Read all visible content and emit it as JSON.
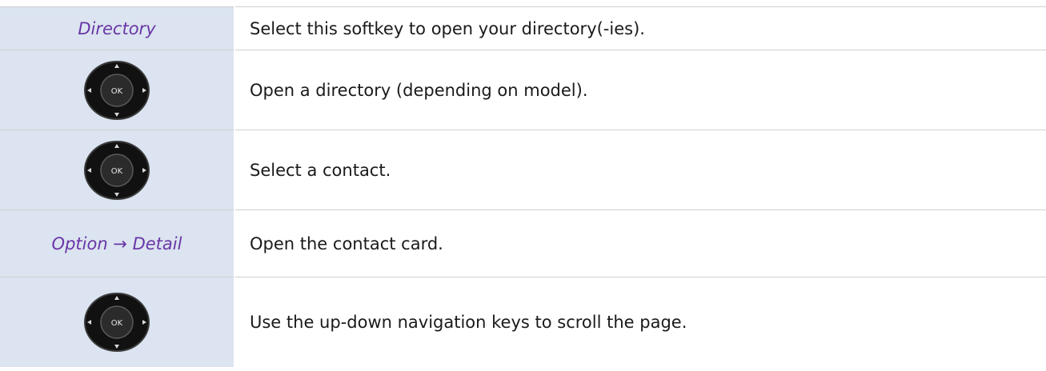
{
  "rows": [
    {
      "key_type": "softkey",
      "key_label": "Directory",
      "description": "Select this softkey to open your directory(-ies)."
    },
    {
      "key_type": "icon",
      "icon": "navigation-ok-key-icon",
      "ok_label": "OK",
      "description": "Open a directory (depending on model)."
    },
    {
      "key_type": "icon",
      "icon": "navigation-ok-key-icon",
      "ok_label": "OK",
      "description": "Select a contact."
    },
    {
      "key_type": "softkey",
      "key_label": "Option → Detail",
      "description": "Open the contact card."
    },
    {
      "key_type": "icon",
      "icon": "navigation-ok-key-icon",
      "ok_label": "OK",
      "description": "Use the up-down navigation keys to scroll the page."
    }
  ],
  "colors": {
    "key_cell_bg": "#dbe4f0",
    "softkey_text": "#6a35a6",
    "body_text": "#1a1a1a",
    "rule": "#d0d0d0"
  }
}
